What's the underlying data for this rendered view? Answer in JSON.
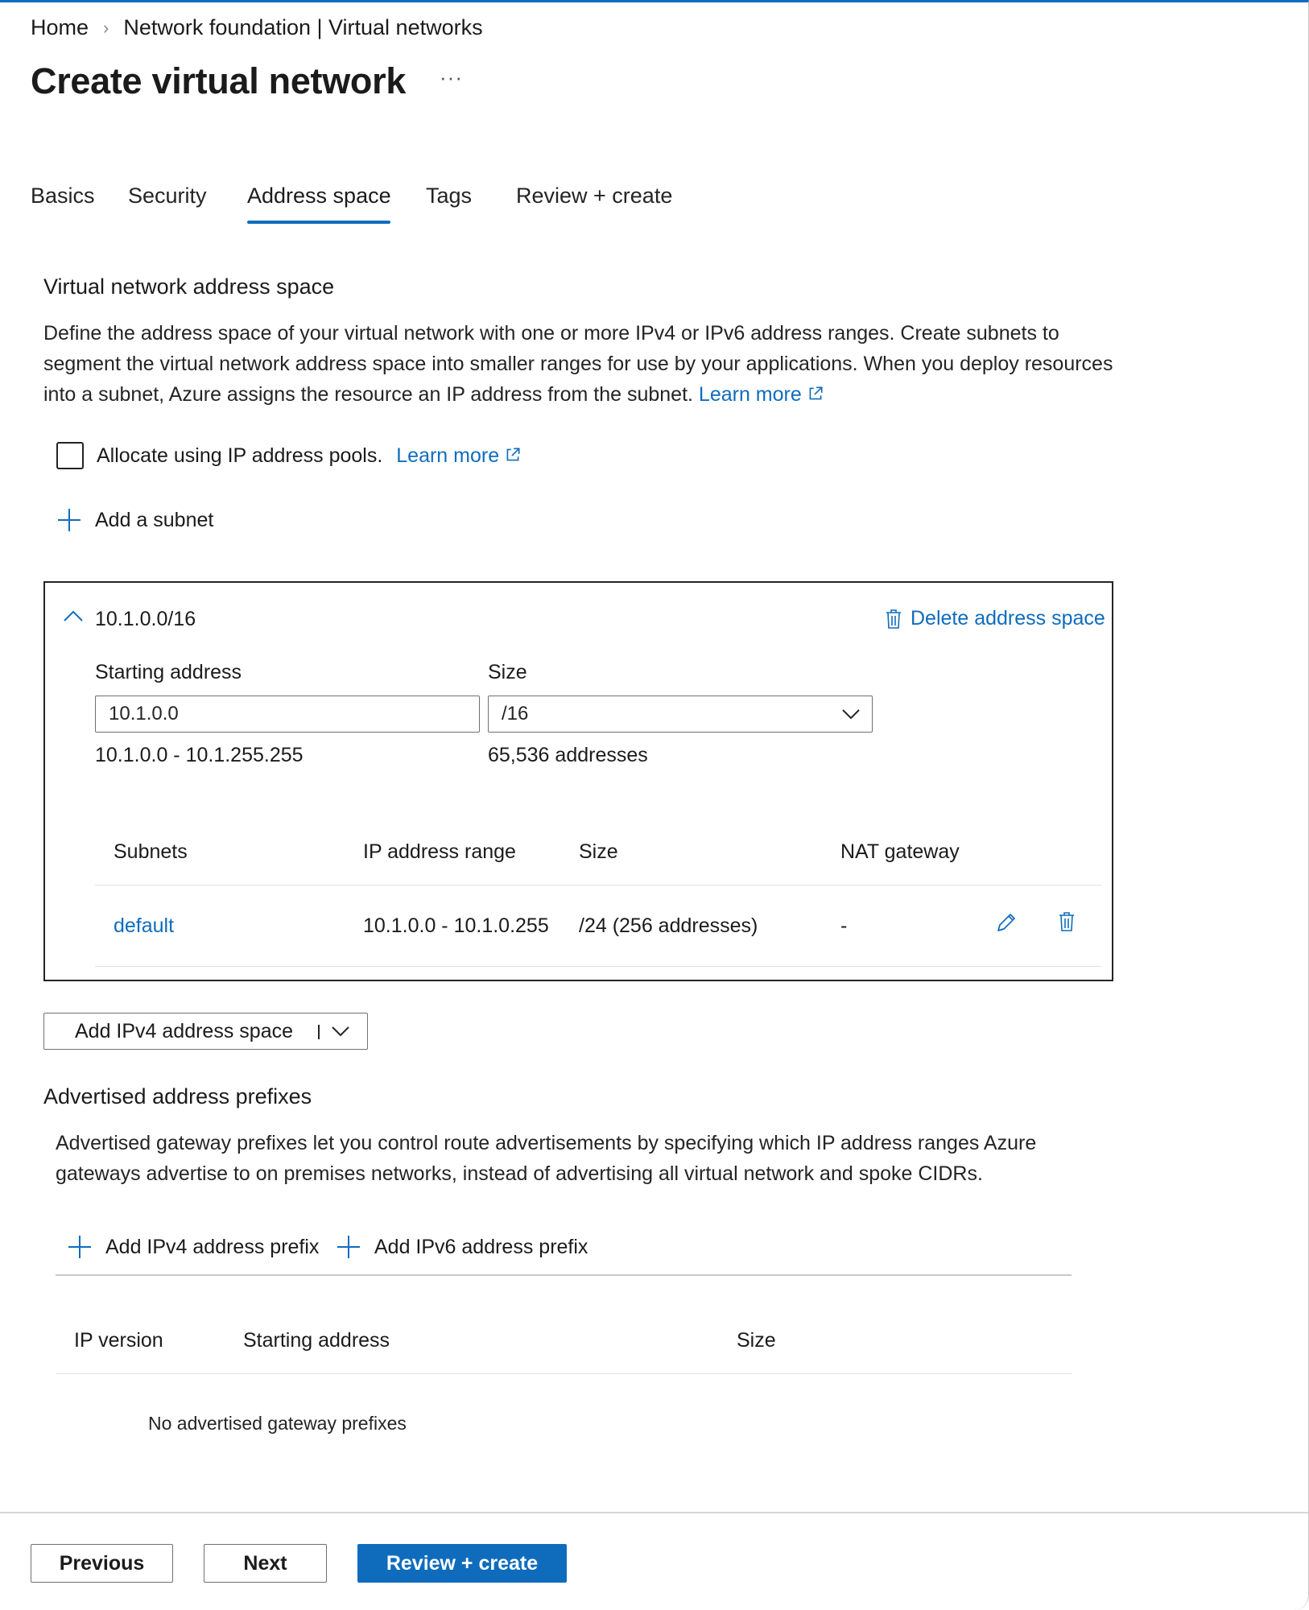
{
  "breadcrumb": {
    "home": "Home",
    "separator": "›",
    "current": "Network foundation | Virtual networks"
  },
  "page": {
    "title": "Create virtual network",
    "more_label": "···"
  },
  "tabs": [
    {
      "label": "Basics",
      "active": false
    },
    {
      "label": "Security",
      "active": false
    },
    {
      "label": "Address space",
      "active": true
    },
    {
      "label": "Tags",
      "active": false
    },
    {
      "label": "Review + create",
      "active": false
    }
  ],
  "address_space_section": {
    "title": "Virtual network address space",
    "description": [
      "Define the address space of your virtual network with one or more IPv4 or IPv6 address ranges. Create subnets to",
      "segment the virtual network address space into smaller ranges for use by your applications. When you deploy resources",
      "into a subnet, Azure assigns the resource an IP address from the subnet."
    ],
    "learn_more": "Learn more",
    "ip_pools_checkbox_label": "Allocate using IP address pools.",
    "ip_pools_learn_more": "Learn more",
    "ip_pools_checked": false,
    "add_subnet_label": "Add a subnet"
  },
  "address_block": {
    "cidr": "10.1.0.0/16",
    "delete_label": "Delete address space",
    "starting_address_label": "Starting address",
    "starting_address_value": "10.1.0.0",
    "size_label": "Size",
    "size_value": "/16",
    "range_text": "10.1.0.0 - 10.1.255.255",
    "address_count": "65,536 addresses",
    "subnet_table": {
      "columns": [
        "Subnets",
        "IP address range",
        "Size",
        "NAT gateway"
      ],
      "rows": [
        {
          "name": "default",
          "range": "10.1.0.0 - 10.1.0.255",
          "size": "/24 (256 addresses)",
          "nat": "-"
        }
      ]
    }
  },
  "add_address_space_button": "Add IPv4 address space",
  "advertised_section": {
    "title": "Advertised address prefixes",
    "description": [
      "Advertised gateway prefixes let you control route advertisements by specifying which IP address ranges Azure",
      "gateways advertise to on premises networks, instead of advertising all virtual network and spoke CIDRs."
    ],
    "add_ipv4_label": "Add IPv4 address prefix",
    "add_ipv6_label": "Add IPv6 address prefix",
    "columns": [
      "IP version",
      "Starting address",
      "Size"
    ],
    "empty_text": "No advertised gateway prefixes"
  },
  "footer": {
    "previous": "Previous",
    "next": "Next",
    "review_create": "Review + create"
  },
  "colors": {
    "accent": "#0f6cbd",
    "text": "#1b1b1b"
  }
}
